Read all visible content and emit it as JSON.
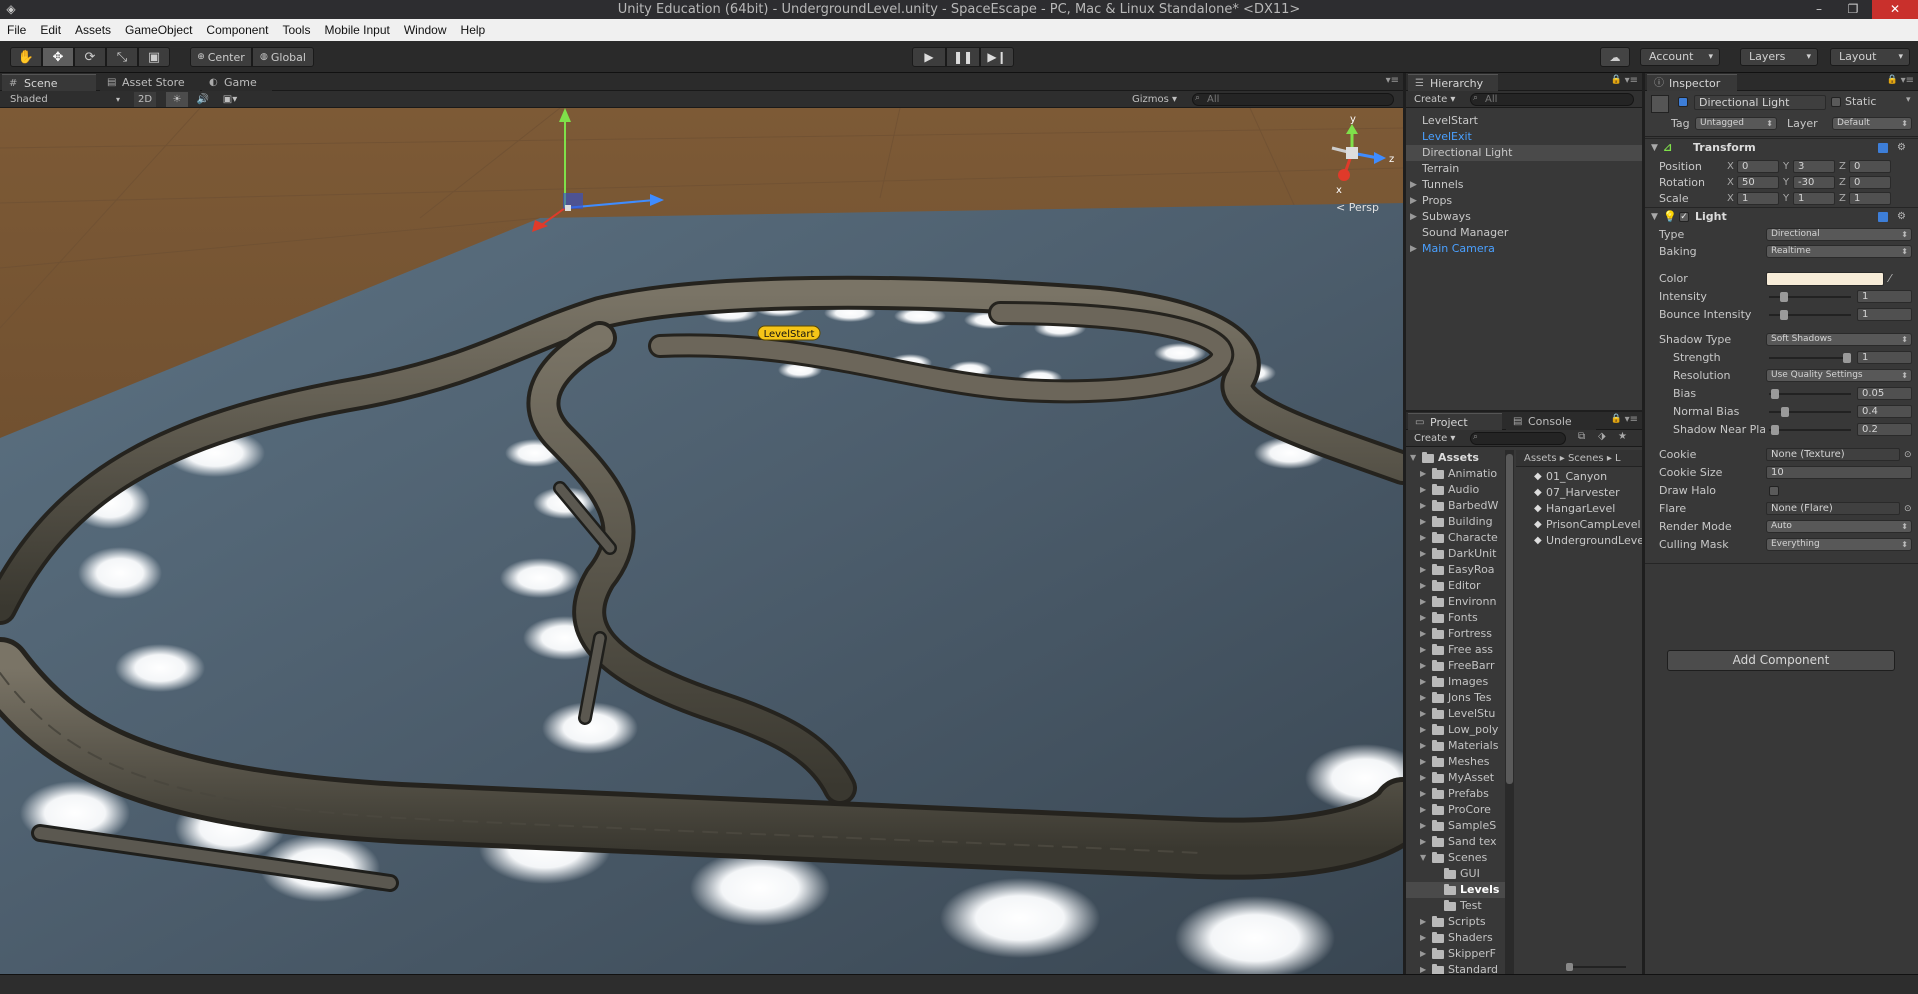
{
  "window": {
    "title": "Unity Education (64bit) - UndergroundLevel.unity - SpaceEscape - PC, Mac & Linux Standalone* <DX11>",
    "controls": {
      "minimize": "–",
      "maximize": "❐",
      "close": "✕"
    }
  },
  "menu": [
    "File",
    "Edit",
    "Assets",
    "GameObject",
    "Component",
    "Tools",
    "Mobile Input",
    "Window",
    "Help"
  ],
  "toolbar": {
    "pivot": "Center",
    "space": "Global",
    "account": "Account",
    "layers": "Layers",
    "layout": "Layout"
  },
  "scene": {
    "tabs": [
      "Scene",
      "Asset Store",
      "Game"
    ],
    "shading": "Shaded",
    "mode_2d": "2D",
    "gizmos": "Gizmos",
    "search_placeholder": "All",
    "persp_label": "Persp",
    "level_label": "LevelStart",
    "axis_labels": {
      "y": "y",
      "z": "z",
      "x": "x"
    }
  },
  "hierarchy": {
    "tab": "Hierarchy",
    "create": "Create",
    "search_placeholder": "All",
    "items": [
      {
        "label": "LevelStart",
        "expandable": false,
        "style": "normal"
      },
      {
        "label": "LevelExit",
        "expandable": false,
        "style": "blue"
      },
      {
        "label": "Directional Light",
        "expandable": false,
        "style": "selected"
      },
      {
        "label": "Terrain",
        "expandable": false,
        "style": "normal"
      },
      {
        "label": "Tunnels",
        "expandable": true,
        "style": "normal"
      },
      {
        "label": "Props",
        "expandable": true,
        "style": "normal"
      },
      {
        "label": "Subways",
        "expandable": true,
        "style": "normal"
      },
      {
        "label": "Sound Manager",
        "expandable": false,
        "style": "normal"
      },
      {
        "label": "Main Camera",
        "expandable": true,
        "style": "blue"
      }
    ]
  },
  "project": {
    "tabs": [
      "Project",
      "Console"
    ],
    "create": "Create",
    "tree_root": "Assets",
    "folders": [
      "Animatio",
      "Audio",
      "BarbedW",
      "Building",
      "Characte",
      "DarkUnit",
      "EasyRoa",
      "Editor",
      "Environn",
      "Fonts",
      "Fortress",
      "Free ass",
      "FreeBarr",
      "Images",
      "Jons Tes",
      "LevelStu",
      "Low_poly",
      "Materials",
      "Meshes",
      "MyAsset",
      "Prefabs",
      "ProCore",
      "SampleS",
      "Sand tex",
      "Scenes",
      "GUI",
      "Levels",
      "Test",
      "Scripts",
      "Shaders",
      "SkipperF",
      "Standard"
    ],
    "breadcrumb": [
      "Assets",
      "Scenes",
      "L"
    ],
    "files": [
      "01_Canyon",
      "07_Harvester",
      "HangarLevel",
      "PrisonCampLevel",
      "UndergroundLevel"
    ]
  },
  "inspector": {
    "tab": "Inspector",
    "object_name": "Directional Light",
    "static_label": "Static",
    "tag_label": "Tag",
    "tag_value": "Untagged",
    "layer_label": "Layer",
    "layer_value": "Default",
    "transform": {
      "title": "Transform",
      "rows": [
        {
          "label": "Position",
          "x": "0",
          "y": "3",
          "z": "0"
        },
        {
          "label": "Rotation",
          "x": "50",
          "y": "-30",
          "z": "0"
        },
        {
          "label": "Scale",
          "x": "1",
          "y": "1",
          "z": "1"
        }
      ]
    },
    "light": {
      "title": "Light",
      "type_label": "Type",
      "type_value": "Directional",
      "baking_label": "Baking",
      "baking_value": "Realtime",
      "color_label": "Color",
      "color_value": "#f7ecd8",
      "intensity_label": "Intensity",
      "intensity_value": "1",
      "bounce_label": "Bounce Intensity",
      "bounce_value": "1",
      "shadow_type_label": "Shadow Type",
      "shadow_type_value": "Soft Shadows",
      "strength_label": "Strength",
      "strength_value": "1",
      "resolution_label": "Resolution",
      "resolution_value": "Use Quality Settings",
      "bias_label": "Bias",
      "bias_value": "0.05",
      "normal_bias_label": "Normal Bias",
      "normal_bias_value": "0.4",
      "near_plane_label": "Shadow Near Plar",
      "near_plane_value": "0.2",
      "cookie_label": "Cookie",
      "cookie_value": "None (Texture)",
      "cookie_size_label": "Cookie Size",
      "cookie_size_value": "10",
      "draw_halo_label": "Draw Halo",
      "flare_label": "Flare",
      "flare_value": "None (Flare)",
      "render_mode_label": "Render Mode",
      "render_mode_value": "Auto",
      "culling_label": "Culling Mask",
      "culling_value": "Everything"
    },
    "add_component": "Add Component"
  }
}
